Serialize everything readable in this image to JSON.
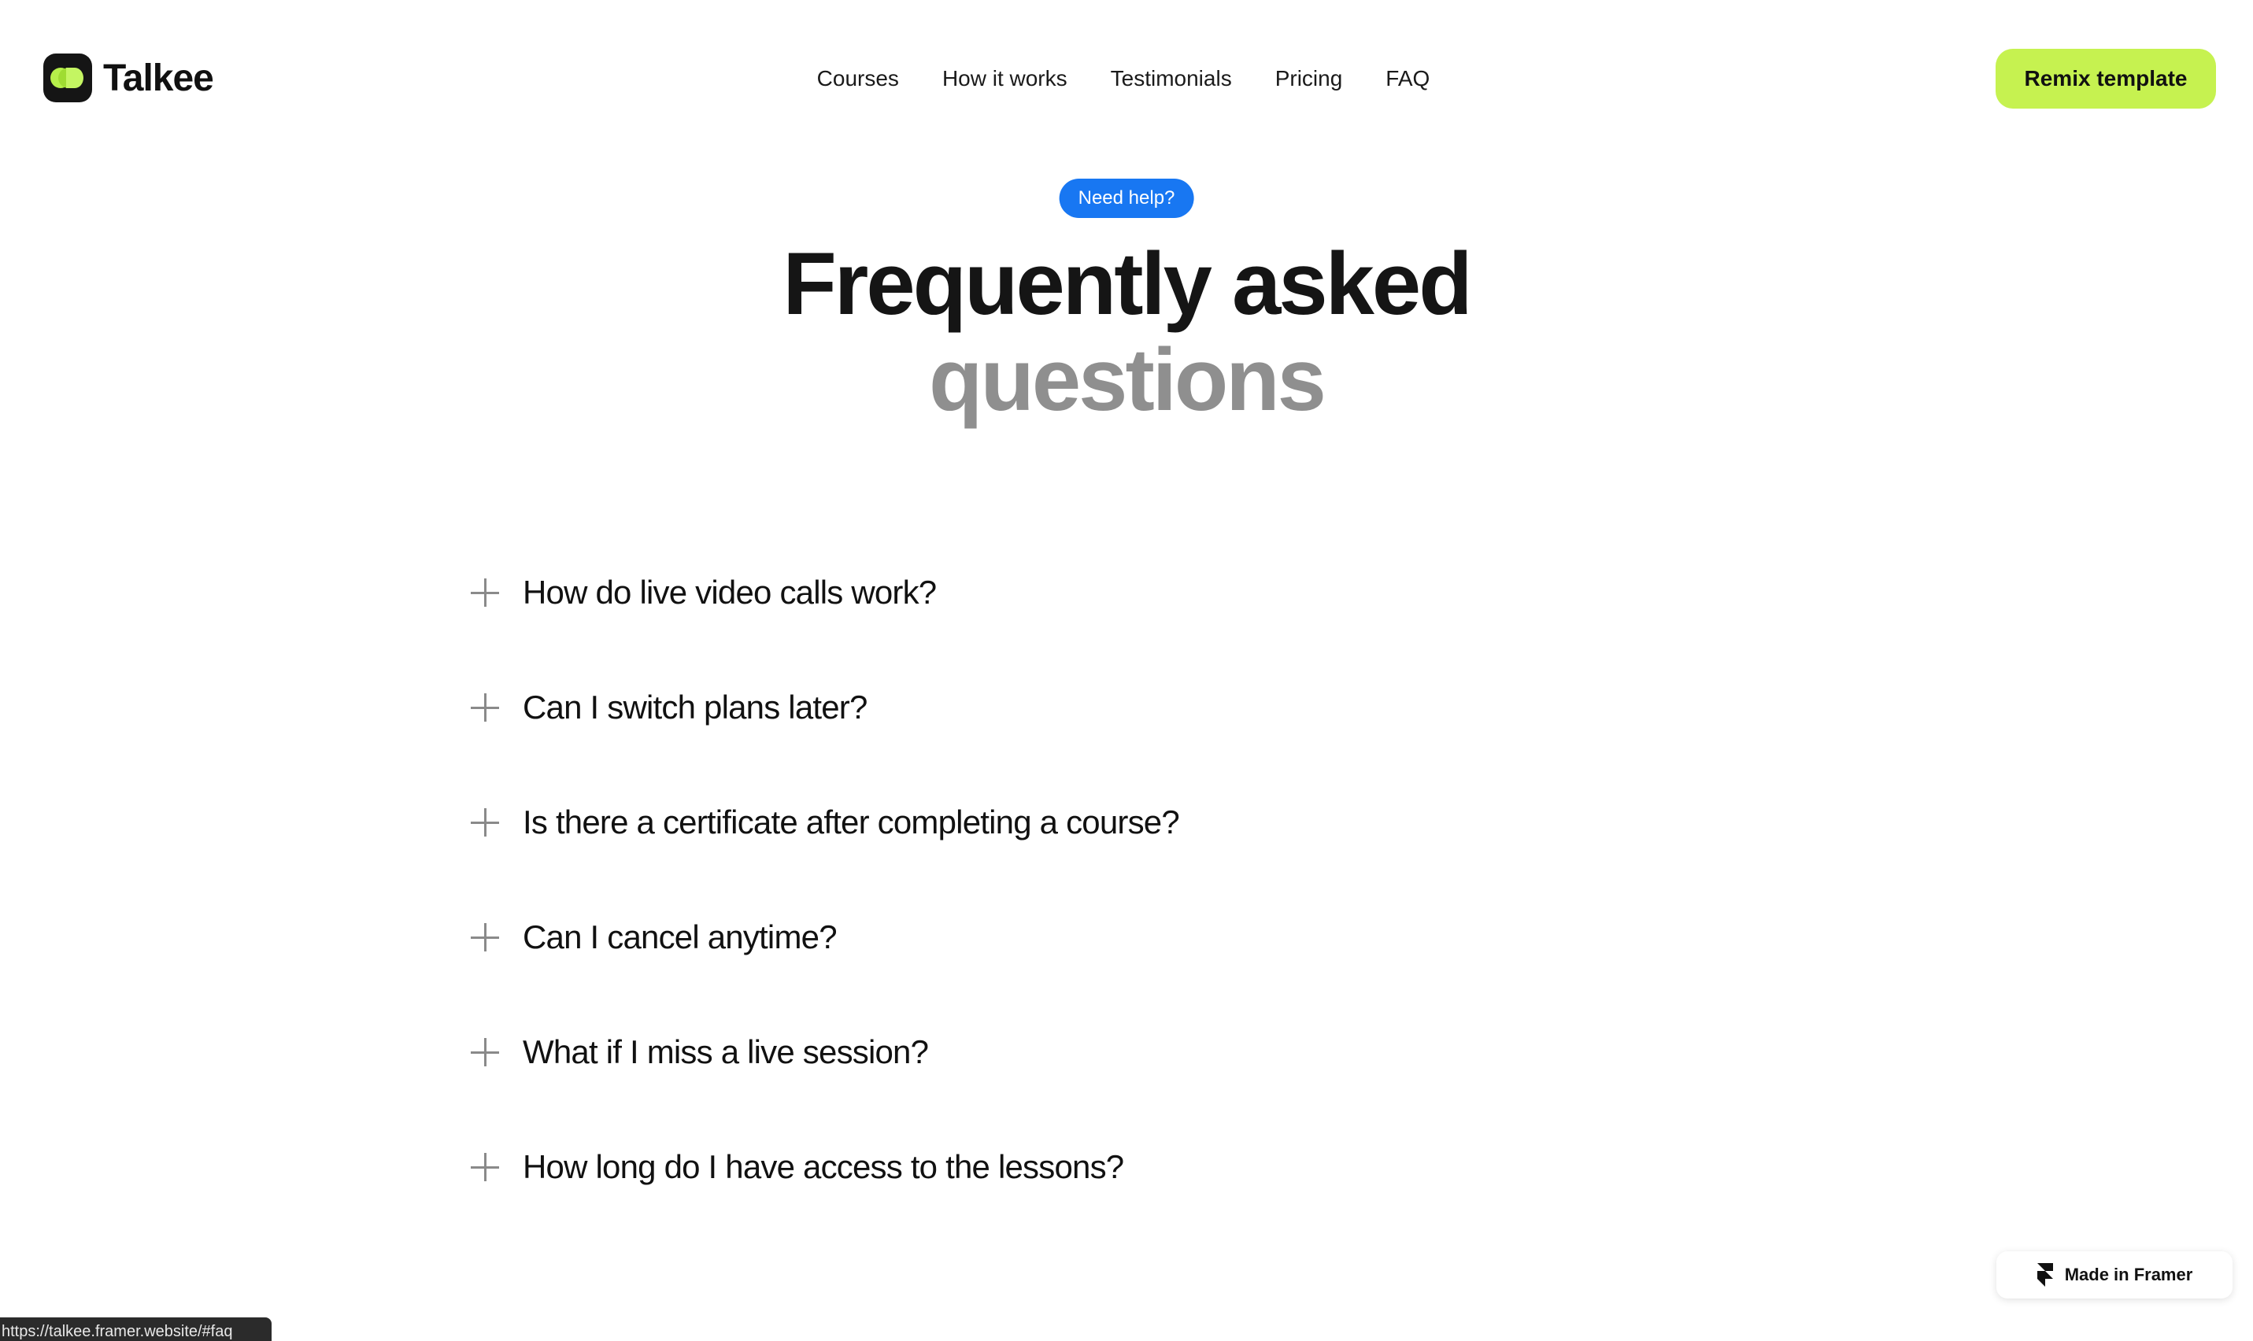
{
  "header": {
    "logo_text": "Talkee",
    "nav": [
      {
        "label": "Courses"
      },
      {
        "label": "How it works"
      },
      {
        "label": "Testimonials"
      },
      {
        "label": "Pricing"
      },
      {
        "label": "FAQ"
      }
    ],
    "cta_label": "Remix template"
  },
  "hero": {
    "badge": "Need help?",
    "title_line1": "Frequently asked",
    "title_line2": "questions"
  },
  "faq": {
    "items": [
      {
        "question": "How do live video calls work?",
        "icon": "plus-icon"
      },
      {
        "question": "Can I switch plans later?",
        "icon": "plus-icon"
      },
      {
        "question": "Is there a certificate after completing a course?",
        "icon": "plus-icon"
      },
      {
        "question": "Can I cancel anytime?",
        "icon": "plus-icon"
      },
      {
        "question": "What if I miss a live session?",
        "icon": "plus-icon"
      },
      {
        "question": "How long do I have access to the lessons?",
        "icon": "plus-icon"
      }
    ]
  },
  "framer_badge": {
    "label": "Made in Framer",
    "icon": "framer-icon"
  },
  "status_bar": {
    "url": "https://talkee.framer.website/#faq"
  },
  "colors": {
    "accent_lime": "#c6f250",
    "badge_blue": "#1877f2",
    "title_dark": "#151515",
    "title_muted": "#8f8f8f"
  }
}
